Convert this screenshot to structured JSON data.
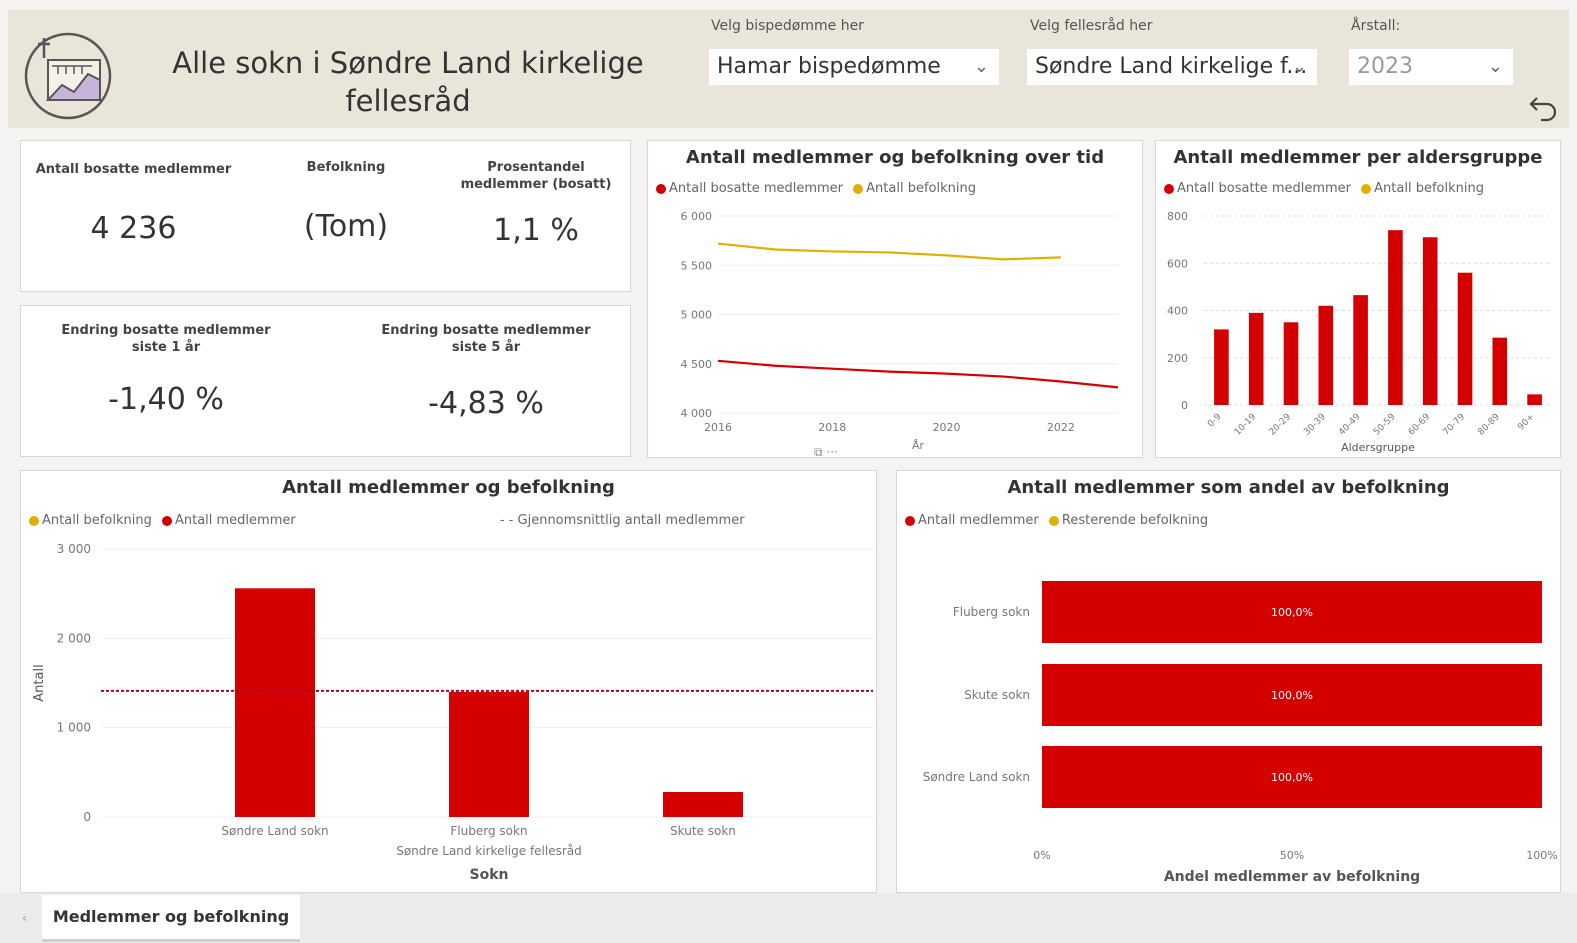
{
  "header": {
    "title": "Alle sokn i Søndre Land kirkelige fellesråd",
    "slicers": [
      {
        "label": "Velg bispedømme her",
        "value": "Hamar bispedømme"
      },
      {
        "label": "Velg fellesråd her",
        "value": "Søndre Land kirkelige f..."
      },
      {
        "label": "Årstall:",
        "value": "2023"
      }
    ],
    "back_icon": "undo-arrow-icon"
  },
  "kpis": {
    "members_label": "Antall bosatte medlemmer",
    "members_value": "4 236",
    "population_label": "Befolkning",
    "population_value": "(Tom)",
    "pct_label": "Prosentandel medlemmer (bosatt)",
    "pct_value": "1,1 %",
    "change1_label": "Endring bosatte medlemmer siste 1 år",
    "change1_value": "-1,40 %",
    "change5_label": "Endring bosatte medlemmer siste 5 år",
    "change5_value": "-4,83 %"
  },
  "colors": {
    "members": "#d40000",
    "population": "#e0b000",
    "header_bg": "#e9e5d9"
  },
  "chart_data": [
    {
      "type": "line",
      "title": "Antall medlemmer og befolkning over tid",
      "xlabel": "År",
      "ylabel": "",
      "x": [
        2016,
        2017,
        2018,
        2019,
        2020,
        2021,
        2022,
        2023
      ],
      "x_ticks": [
        "2016",
        "2018",
        "2020",
        "2022"
      ],
      "y_ticks": [
        "6 000",
        "5 500",
        "5 000",
        "4 500",
        "4 000"
      ],
      "ylim": [
        4000,
        6000
      ],
      "legend_position": "top-left",
      "series": [
        {
          "name": "Antall bosatte medlemmer",
          "color": "#d40000",
          "values": [
            4530,
            4480,
            4450,
            4420,
            4400,
            4370,
            4320,
            4260
          ]
        },
        {
          "name": "Antall befolkning",
          "color": "#e0b000",
          "values": [
            5720,
            5660,
            5640,
            5630,
            5600,
            5560,
            5580,
            null
          ]
        }
      ]
    },
    {
      "type": "bar",
      "title": "Antall medlemmer per aldersgruppe",
      "xlabel": "Aldersgruppe",
      "ylabel": "",
      "categories": [
        "0-9",
        "10-19",
        "20-29",
        "30-39",
        "40-49",
        "50-59",
        "60-69",
        "70-79",
        "80-89",
        "90+"
      ],
      "y_ticks": [
        "800",
        "600",
        "400",
        "200",
        "0"
      ],
      "ylim": [
        0,
        800
      ],
      "legend_position": "top-left",
      "series": [
        {
          "name": "Antall bosatte medlemmer",
          "color": "#d40000",
          "values": [
            320,
            390,
            350,
            420,
            465,
            740,
            710,
            560,
            285,
            45
          ]
        },
        {
          "name": "Antall befolkning",
          "color": "#e0b000",
          "values": [
            0,
            0,
            0,
            0,
            0,
            0,
            0,
            0,
            0,
            0
          ]
        }
      ]
    },
    {
      "type": "bar",
      "title": "Antall medlemmer og befolkning",
      "xlabel": "Sokn",
      "ylabel": "Antall",
      "group_label": "Søndre Land kirkelige fellesråd",
      "categories": [
        "Søndre Land sokn",
        "Fluberg sokn",
        "Skute sokn"
      ],
      "y_ticks": [
        "3 000",
        "2 000",
        "1 000",
        "0"
      ],
      "ylim": [
        0,
        3000
      ],
      "legend_position": "top-left",
      "series": [
        {
          "name": "Antall befolkning",
          "color": "#e0b000",
          "values": [
            0,
            0,
            0
          ]
        },
        {
          "name": "Antall medlemmer",
          "color": "#d40000",
          "values": [
            2560,
            1400,
            280
          ]
        }
      ],
      "reference_line": {
        "name": "Gjennomsnittlig antall medlemmer",
        "value": 1412
      }
    },
    {
      "type": "bar",
      "orientation": "horizontal",
      "title": "Antall medlemmer som andel av befolkning",
      "xlabel": "Andel medlemmer av befolkning",
      "ylabel": "",
      "categories": [
        "Fluberg sokn",
        "Skute sokn",
        "Søndre Land sokn"
      ],
      "x_ticks": [
        "0%",
        "50%",
        "100%"
      ],
      "xlim": [
        0,
        1
      ],
      "legend_position": "top-left",
      "series": [
        {
          "name": "Antall medlemmer",
          "color": "#d40000",
          "values": [
            1.0,
            1.0,
            1.0
          ],
          "labels": [
            "100,0%",
            "100,0%",
            "100,0%"
          ]
        },
        {
          "name": "Resterende befolkning",
          "color": "#e0b000",
          "values": [
            0,
            0,
            0
          ]
        }
      ]
    }
  ],
  "tabs": [
    {
      "label": "Medlemmer og befolkning"
    }
  ]
}
